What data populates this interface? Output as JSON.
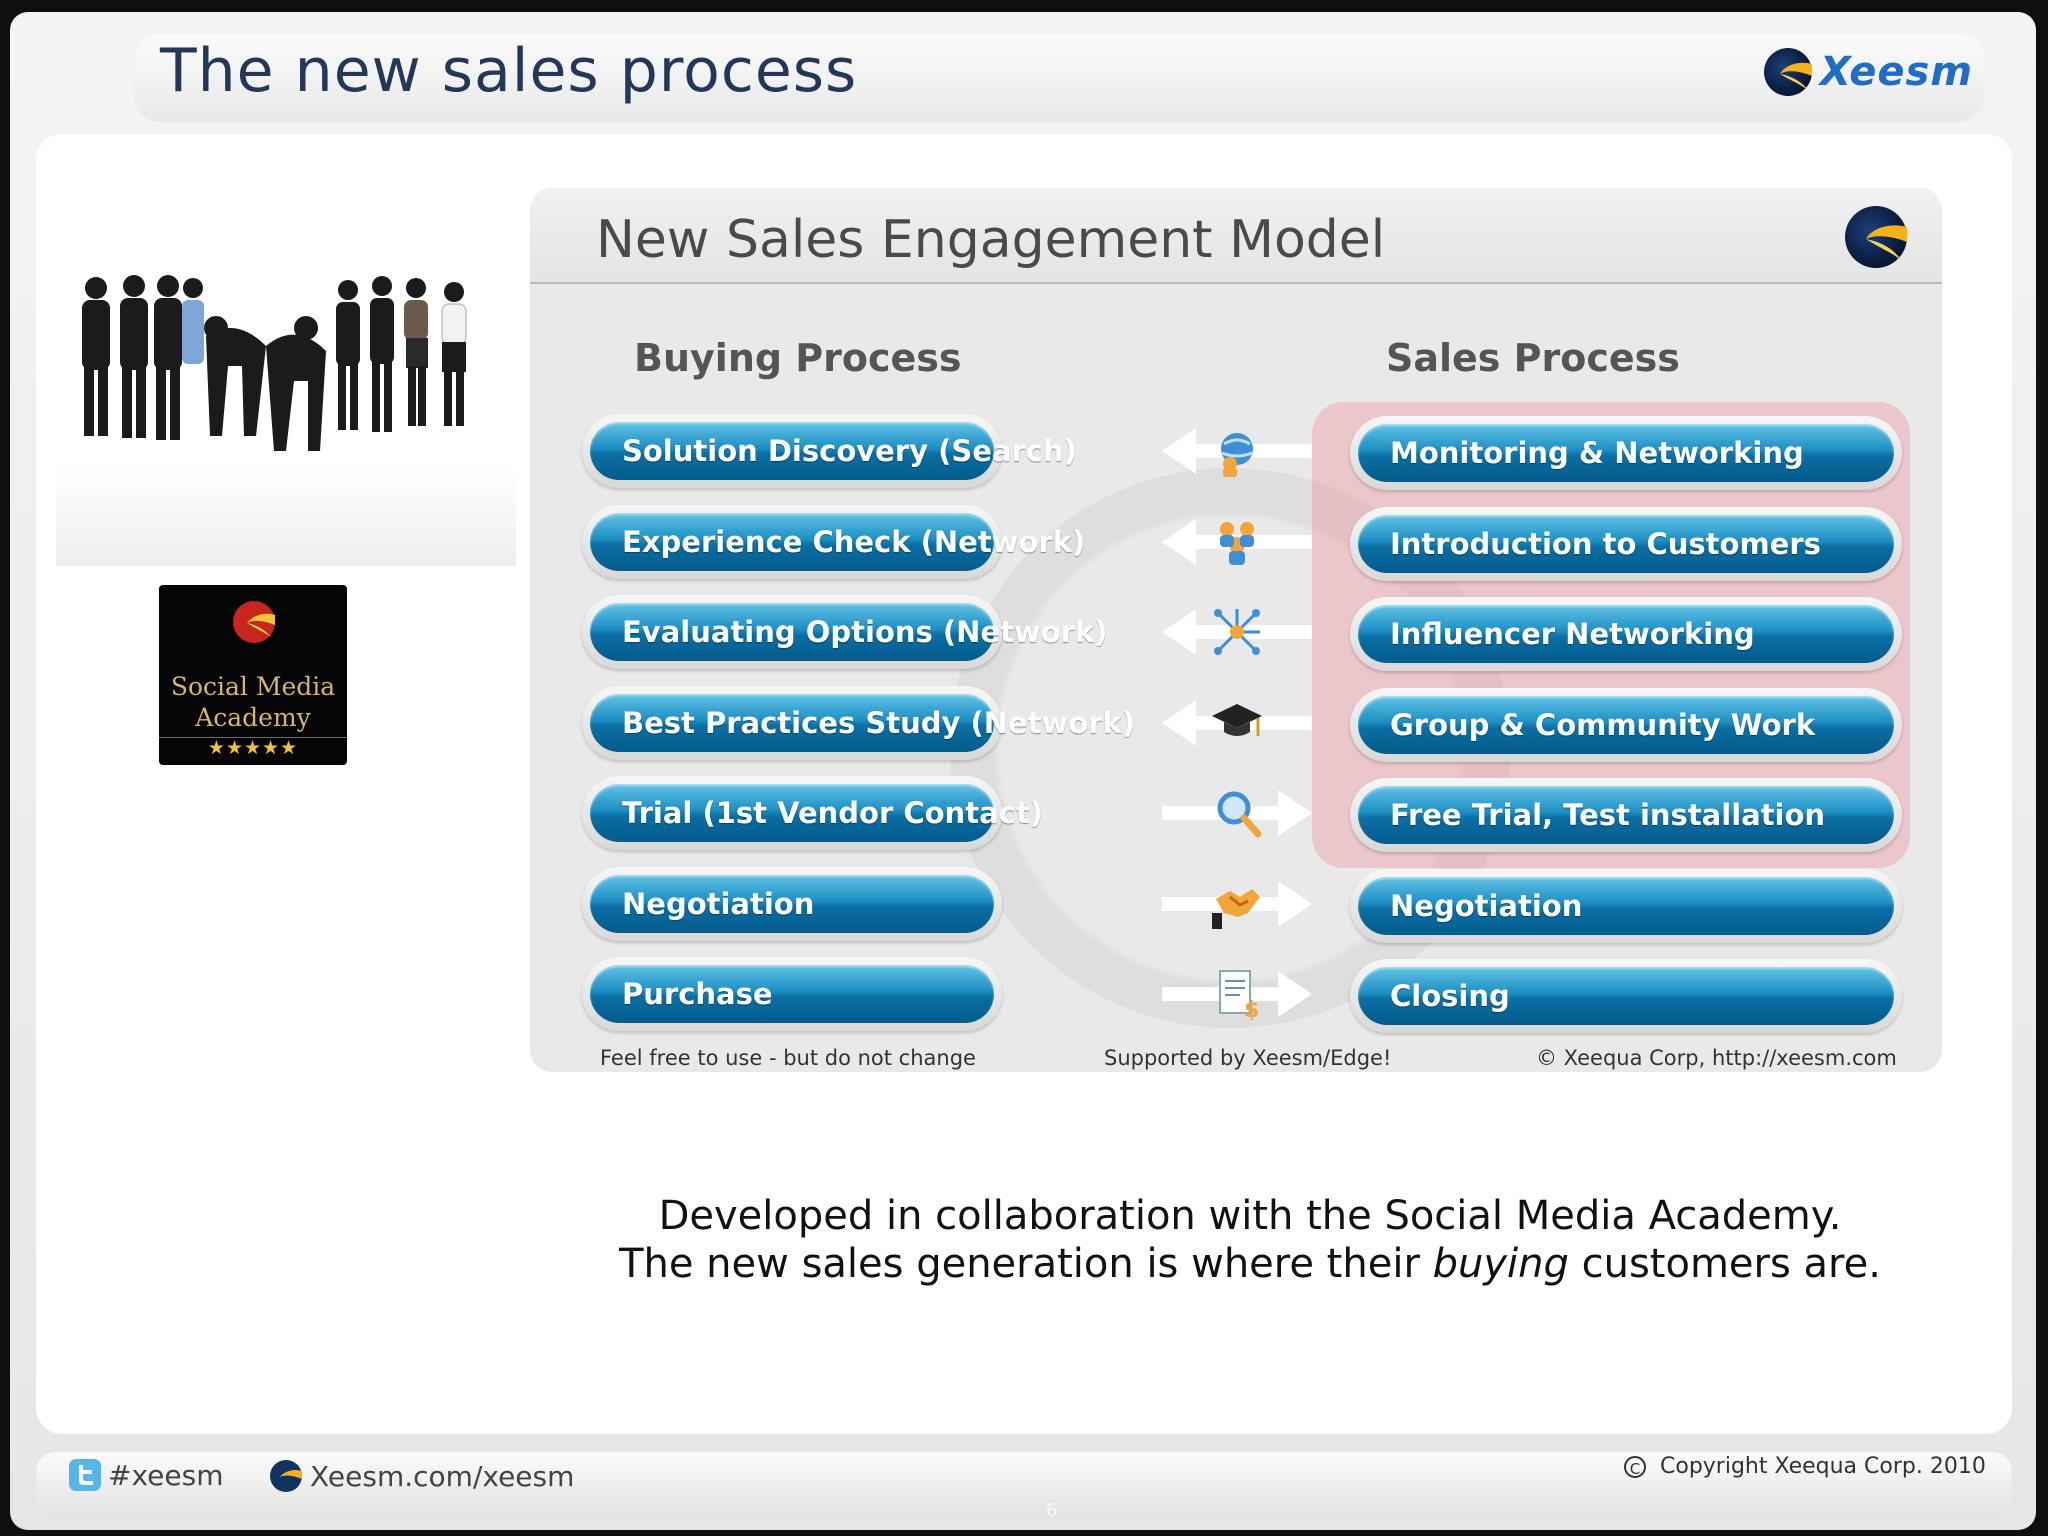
{
  "slide": {
    "title": "The new sales process",
    "brand": "Xeesm",
    "page_number": "6"
  },
  "badge": {
    "line1": "Social Media",
    "line2": "Academy",
    "stars": "★★★★★"
  },
  "model": {
    "title": "New Sales Engagement Model",
    "buying_header": "Buying Process",
    "sales_header": "Sales Process",
    "rows": [
      {
        "buying": "Solution Discovery (Search)",
        "sales": "Monitoring & Networking",
        "direction": "left",
        "icon": "globe-people-icon"
      },
      {
        "buying": "Experience Check (Network)",
        "sales": "Introduction to Customers",
        "direction": "left",
        "icon": "people-group-icon"
      },
      {
        "buying": "Evaluating Options (Network)",
        "sales": "Influencer Networking",
        "direction": "left",
        "icon": "network-icon"
      },
      {
        "buying": "Best Practices Study (Network)",
        "sales": "Group & Community Work",
        "direction": "left",
        "icon": "graduation-cap-icon"
      },
      {
        "buying": "Trial (1st Vendor Contact)",
        "sales": "Free Trial, Test installation",
        "direction": "right",
        "icon": "magnifier-icon"
      },
      {
        "buying": "Negotiation",
        "sales": "Negotiation",
        "direction": "right",
        "icon": "handshake-icon"
      },
      {
        "buying": "Purchase",
        "sales": "Closing",
        "direction": "right",
        "icon": "document-money-icon"
      }
    ],
    "footer_left": "Feel free to use - but do not change",
    "footer_center": "Supported by Xeesm/Edge!",
    "footer_right": "© Xeequa Corp, http://xeesm.com"
  },
  "caption": {
    "line1": "Developed in collaboration with the Social Media Academy.",
    "line2_before": "The new sales generation is where their ",
    "line2_emphasis": "buying",
    "line2_after": " customers are."
  },
  "footer": {
    "twitter": "#xeesm",
    "site": "Xeesm.com/xeesm",
    "copyright": "Copyright Xeequa Corp. 2010"
  },
  "colors": {
    "title": "#23375a",
    "pill": "#0a6fa4",
    "highlight": "#ee96a0",
    "brand": "#1f6dc4"
  }
}
